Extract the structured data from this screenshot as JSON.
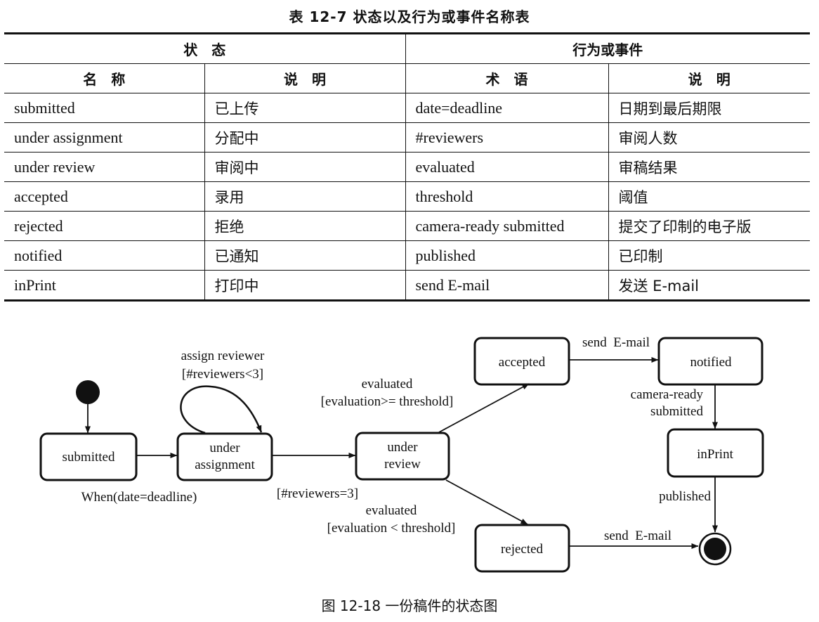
{
  "table": {
    "title": "表 12-7   状态以及行为或事件名称表",
    "group_headers": [
      "状　态",
      "行为或事件"
    ],
    "column_headers": [
      "名　称",
      "说　明",
      "术　语",
      "说　明"
    ],
    "rows": [
      [
        "submitted",
        "已上传",
        "date=deadline",
        "日期到最后期限"
      ],
      [
        "under assignment",
        "分配中",
        "#reviewers",
        "审阅人数"
      ],
      [
        "under review",
        "审阅中",
        "evaluated",
        "审稿结果"
      ],
      [
        "accepted",
        "录用",
        "threshold",
        "阈值"
      ],
      [
        "rejected",
        "拒绝",
        "camera-ready submitted",
        "提交了印制的电子版"
      ],
      [
        "notified",
        "已通知",
        "published",
        "已印制"
      ],
      [
        "inPrint",
        "打印中",
        "send E-mail",
        "发送 E-mail"
      ]
    ]
  },
  "diagram": {
    "states": {
      "submitted": [
        "submitted"
      ],
      "under_assignment": [
        "under",
        "assignment"
      ],
      "under_review": [
        "under",
        "review"
      ],
      "accepted": [
        "accepted"
      ],
      "rejected": [
        "rejected"
      ],
      "notified": [
        "notified"
      ],
      "inPrint": [
        "inPrint"
      ]
    },
    "transitions": {
      "submitted_to_assignment": [
        "When(date=deadline)"
      ],
      "self_loop": [
        "assign reviewer",
        "[#reviewers<3]"
      ],
      "assignment_to_review": [
        "[#reviewers=3]"
      ],
      "review_to_accepted": [
        "evaluated",
        "[evaluation>= threshold]"
      ],
      "review_to_rejected": [
        "evaluated",
        "[evaluation < threshold]"
      ],
      "accepted_to_notified": [
        "send  E-mail"
      ],
      "notified_to_inprint": [
        "camera-ready",
        "submitted"
      ],
      "inprint_to_final": [
        "published"
      ],
      "rejected_to_final": [
        "send  E-mail"
      ]
    }
  },
  "caption": "图 12-18    一份稿件的状态图"
}
